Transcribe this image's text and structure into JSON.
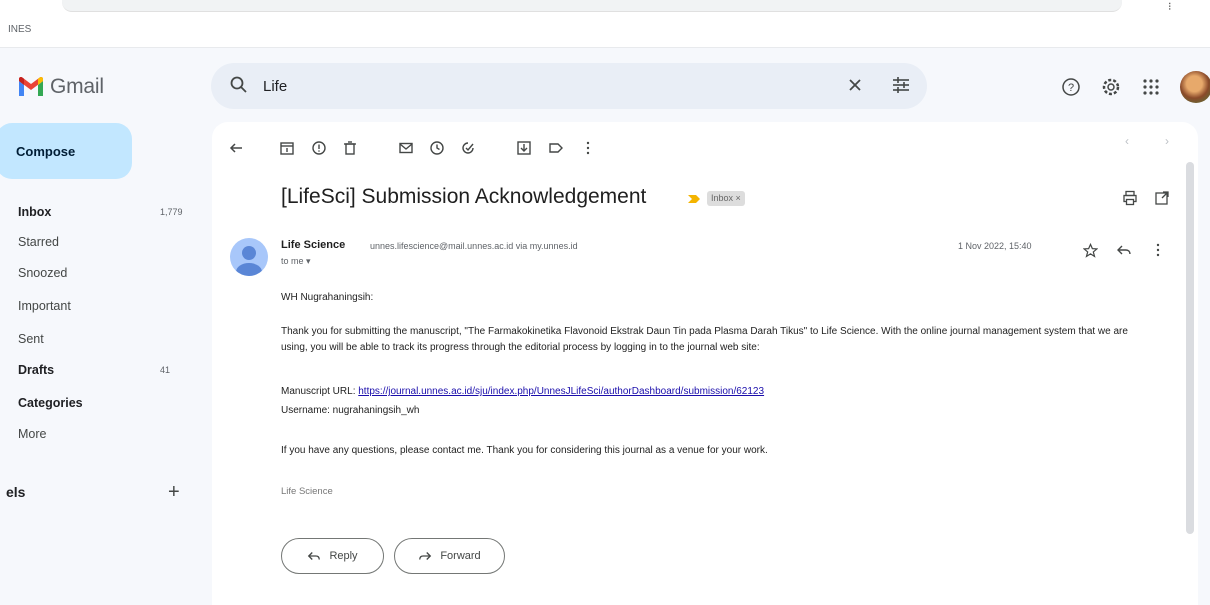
{
  "browser": {
    "bookmark_label": "INES"
  },
  "app": {
    "name": "Gmail",
    "colors": {
      "compose_bg": "#c2e7ff",
      "link": "#1a0dab",
      "search_bg": "#e9eef6"
    }
  },
  "search": {
    "value": "Life"
  },
  "header_icons": [
    "help-icon",
    "settings-icon",
    "apps-grid-icon",
    "account-avatar"
  ],
  "sidebar": {
    "compose_label": "Compose",
    "items": [
      {
        "label": "Inbox",
        "count": "1,779",
        "bold": true
      },
      {
        "label": "Starred",
        "count": ""
      },
      {
        "label": "Snoozed",
        "count": ""
      },
      {
        "label": "Important",
        "count": ""
      },
      {
        "label": "Sent",
        "count": ""
      },
      {
        "label": "Drafts",
        "count": "41",
        "bold": true
      },
      {
        "label": "Categories",
        "count": "",
        "bold": true
      },
      {
        "label": "More",
        "count": ""
      }
    ],
    "labels_heading": "els",
    "labels_add": "+"
  },
  "toolbar": {
    "icons": [
      "back-arrow-icon",
      "archive-icon",
      "report-spam-icon",
      "delete-icon",
      "mark-unread-icon",
      "snooze-icon",
      "add-task-icon",
      "move-to-icon",
      "label-icon",
      "more-vert-icon"
    ]
  },
  "email": {
    "subject": "[LifeSci] Submission Acknowledgement",
    "badge": "Inbox ×",
    "sender_name": "Life Science",
    "sender_email": "unnes.lifescience@mail.unnes.ac.id via my.unnes.id",
    "to": "to me ▾",
    "date": "1 Nov 2022, 15:40",
    "greeting": "WH Nugrahaningsih:",
    "para1": "Thank you for submitting the manuscript, \"The Farmakokinetika Flavonoid Ekstrak Daun Tin pada Plasma Darah Tikus\" to Life Science. With the online journal management system that we are using, you will be able to track its progress through the editorial process by logging in to the journal web site:",
    "url_label": "Manuscript URL: ",
    "url": "https://journal.unnes.ac.id/sju/index.php/UnnesJLifeSci/authorDashboard/submission/62123",
    "username": "Username: nugrahaningsih_wh",
    "para2": "If you have any questions, please contact me. Thank you for considering this journal as a venue for your work.",
    "signature": "Life Science"
  },
  "actions": {
    "reply_label": "Reply",
    "forward_label": "Forward"
  }
}
